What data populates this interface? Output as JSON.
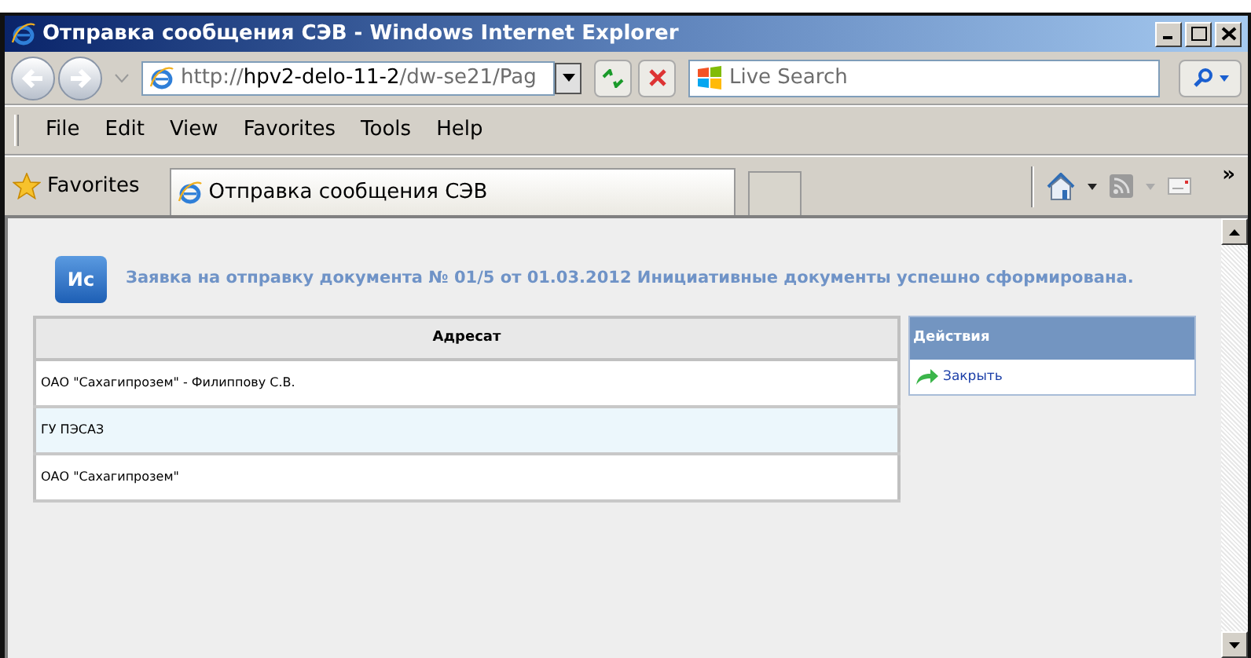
{
  "window": {
    "title": "Отправка сообщения СЭВ - Windows Internet Explorer"
  },
  "address": {
    "url_scheme": "http://",
    "url_host": "hpv2-delo-11-2",
    "url_path": "/dw-se21/Pag"
  },
  "search": {
    "placeholder": "Live Search"
  },
  "menu": [
    "File",
    "Edit",
    "View",
    "Favorites",
    "Tools",
    "Help"
  ],
  "favorites_bar": {
    "label": "Favorites",
    "tab_title": "Отправка сообщения СЭВ",
    "overflow": "»"
  },
  "message": {
    "badge": "Ис",
    "text": "Заявка на отправку документа № 01/5 от 01.03.2012 Инициативные документы успешно сформирована."
  },
  "table": {
    "columns": [
      "Адресат"
    ],
    "rows": [
      {
        "cells": [
          "ОАО \"Сахагипрозем\" - Филиппову С.В."
        ],
        "highlighted": false
      },
      {
        "cells": [
          "ГУ ПЭСАЗ"
        ],
        "highlighted": true
      },
      {
        "cells": [
          "ОАО \"Сахагипрозем\""
        ],
        "highlighted": false
      }
    ]
  },
  "actions": {
    "title": "Действия",
    "items": [
      "Закрыть"
    ]
  }
}
